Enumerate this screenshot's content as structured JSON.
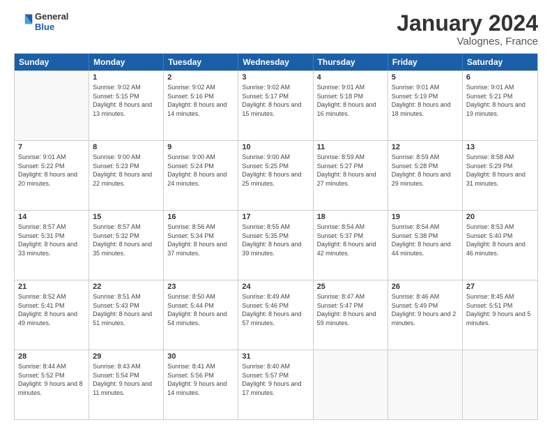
{
  "logo": {
    "general": "General",
    "blue": "Blue"
  },
  "header": {
    "month": "January 2024",
    "location": "Valognes, France"
  },
  "weekdays": [
    "Sunday",
    "Monday",
    "Tuesday",
    "Wednesday",
    "Thursday",
    "Friday",
    "Saturday"
  ],
  "rows": [
    [
      {
        "day": "",
        "sunrise": "",
        "sunset": "",
        "daylight": "",
        "empty": true
      },
      {
        "day": "1",
        "sunrise": "Sunrise: 9:02 AM",
        "sunset": "Sunset: 5:15 PM",
        "daylight": "Daylight: 8 hours and 13 minutes."
      },
      {
        "day": "2",
        "sunrise": "Sunrise: 9:02 AM",
        "sunset": "Sunset: 5:16 PM",
        "daylight": "Daylight: 8 hours and 14 minutes."
      },
      {
        "day": "3",
        "sunrise": "Sunrise: 9:02 AM",
        "sunset": "Sunset: 5:17 PM",
        "daylight": "Daylight: 8 hours and 15 minutes."
      },
      {
        "day": "4",
        "sunrise": "Sunrise: 9:01 AM",
        "sunset": "Sunset: 5:18 PM",
        "daylight": "Daylight: 8 hours and 16 minutes."
      },
      {
        "day": "5",
        "sunrise": "Sunrise: 9:01 AM",
        "sunset": "Sunset: 5:19 PM",
        "daylight": "Daylight: 8 hours and 18 minutes."
      },
      {
        "day": "6",
        "sunrise": "Sunrise: 9:01 AM",
        "sunset": "Sunset: 5:21 PM",
        "daylight": "Daylight: 8 hours and 19 minutes."
      }
    ],
    [
      {
        "day": "7",
        "sunrise": "Sunrise: 9:01 AM",
        "sunset": "Sunset: 5:22 PM",
        "daylight": "Daylight: 8 hours and 20 minutes."
      },
      {
        "day": "8",
        "sunrise": "Sunrise: 9:00 AM",
        "sunset": "Sunset: 5:23 PM",
        "daylight": "Daylight: 8 hours and 22 minutes."
      },
      {
        "day": "9",
        "sunrise": "Sunrise: 9:00 AM",
        "sunset": "Sunset: 5:24 PM",
        "daylight": "Daylight: 8 hours and 24 minutes."
      },
      {
        "day": "10",
        "sunrise": "Sunrise: 9:00 AM",
        "sunset": "Sunset: 5:25 PM",
        "daylight": "Daylight: 8 hours and 25 minutes."
      },
      {
        "day": "11",
        "sunrise": "Sunrise: 8:59 AM",
        "sunset": "Sunset: 5:27 PM",
        "daylight": "Daylight: 8 hours and 27 minutes."
      },
      {
        "day": "12",
        "sunrise": "Sunrise: 8:59 AM",
        "sunset": "Sunset: 5:28 PM",
        "daylight": "Daylight: 8 hours and 29 minutes."
      },
      {
        "day": "13",
        "sunrise": "Sunrise: 8:58 AM",
        "sunset": "Sunset: 5:29 PM",
        "daylight": "Daylight: 8 hours and 31 minutes."
      }
    ],
    [
      {
        "day": "14",
        "sunrise": "Sunrise: 8:57 AM",
        "sunset": "Sunset: 5:31 PM",
        "daylight": "Daylight: 8 hours and 33 minutes."
      },
      {
        "day": "15",
        "sunrise": "Sunrise: 8:57 AM",
        "sunset": "Sunset: 5:32 PM",
        "daylight": "Daylight: 8 hours and 35 minutes."
      },
      {
        "day": "16",
        "sunrise": "Sunrise: 8:56 AM",
        "sunset": "Sunset: 5:34 PM",
        "daylight": "Daylight: 8 hours and 37 minutes."
      },
      {
        "day": "17",
        "sunrise": "Sunrise: 8:55 AM",
        "sunset": "Sunset: 5:35 PM",
        "daylight": "Daylight: 8 hours and 39 minutes."
      },
      {
        "day": "18",
        "sunrise": "Sunrise: 8:54 AM",
        "sunset": "Sunset: 5:37 PM",
        "daylight": "Daylight: 8 hours and 42 minutes."
      },
      {
        "day": "19",
        "sunrise": "Sunrise: 8:54 AM",
        "sunset": "Sunset: 5:38 PM",
        "daylight": "Daylight: 8 hours and 44 minutes."
      },
      {
        "day": "20",
        "sunrise": "Sunrise: 8:53 AM",
        "sunset": "Sunset: 5:40 PM",
        "daylight": "Daylight: 8 hours and 46 minutes."
      }
    ],
    [
      {
        "day": "21",
        "sunrise": "Sunrise: 8:52 AM",
        "sunset": "Sunset: 5:41 PM",
        "daylight": "Daylight: 8 hours and 49 minutes."
      },
      {
        "day": "22",
        "sunrise": "Sunrise: 8:51 AM",
        "sunset": "Sunset: 5:43 PM",
        "daylight": "Daylight: 8 hours and 51 minutes."
      },
      {
        "day": "23",
        "sunrise": "Sunrise: 8:50 AM",
        "sunset": "Sunset: 5:44 PM",
        "daylight": "Daylight: 8 hours and 54 minutes."
      },
      {
        "day": "24",
        "sunrise": "Sunrise: 8:49 AM",
        "sunset": "Sunset: 5:46 PM",
        "daylight": "Daylight: 8 hours and 57 minutes."
      },
      {
        "day": "25",
        "sunrise": "Sunrise: 8:47 AM",
        "sunset": "Sunset: 5:47 PM",
        "daylight": "Daylight: 8 hours and 59 minutes."
      },
      {
        "day": "26",
        "sunrise": "Sunrise: 8:46 AM",
        "sunset": "Sunset: 5:49 PM",
        "daylight": "Daylight: 9 hours and 2 minutes."
      },
      {
        "day": "27",
        "sunrise": "Sunrise: 8:45 AM",
        "sunset": "Sunset: 5:51 PM",
        "daylight": "Daylight: 9 hours and 5 minutes."
      }
    ],
    [
      {
        "day": "28",
        "sunrise": "Sunrise: 8:44 AM",
        "sunset": "Sunset: 5:52 PM",
        "daylight": "Daylight: 9 hours and 8 minutes."
      },
      {
        "day": "29",
        "sunrise": "Sunrise: 8:43 AM",
        "sunset": "Sunset: 5:54 PM",
        "daylight": "Daylight: 9 hours and 11 minutes."
      },
      {
        "day": "30",
        "sunrise": "Sunrise: 8:41 AM",
        "sunset": "Sunset: 5:56 PM",
        "daylight": "Daylight: 9 hours and 14 minutes."
      },
      {
        "day": "31",
        "sunrise": "Sunrise: 8:40 AM",
        "sunset": "Sunset: 5:57 PM",
        "daylight": "Daylight: 9 hours and 17 minutes."
      },
      {
        "day": "",
        "sunrise": "",
        "sunset": "",
        "daylight": "",
        "empty": true
      },
      {
        "day": "",
        "sunrise": "",
        "sunset": "",
        "daylight": "",
        "empty": true
      },
      {
        "day": "",
        "sunrise": "",
        "sunset": "",
        "daylight": "",
        "empty": true
      }
    ]
  ]
}
